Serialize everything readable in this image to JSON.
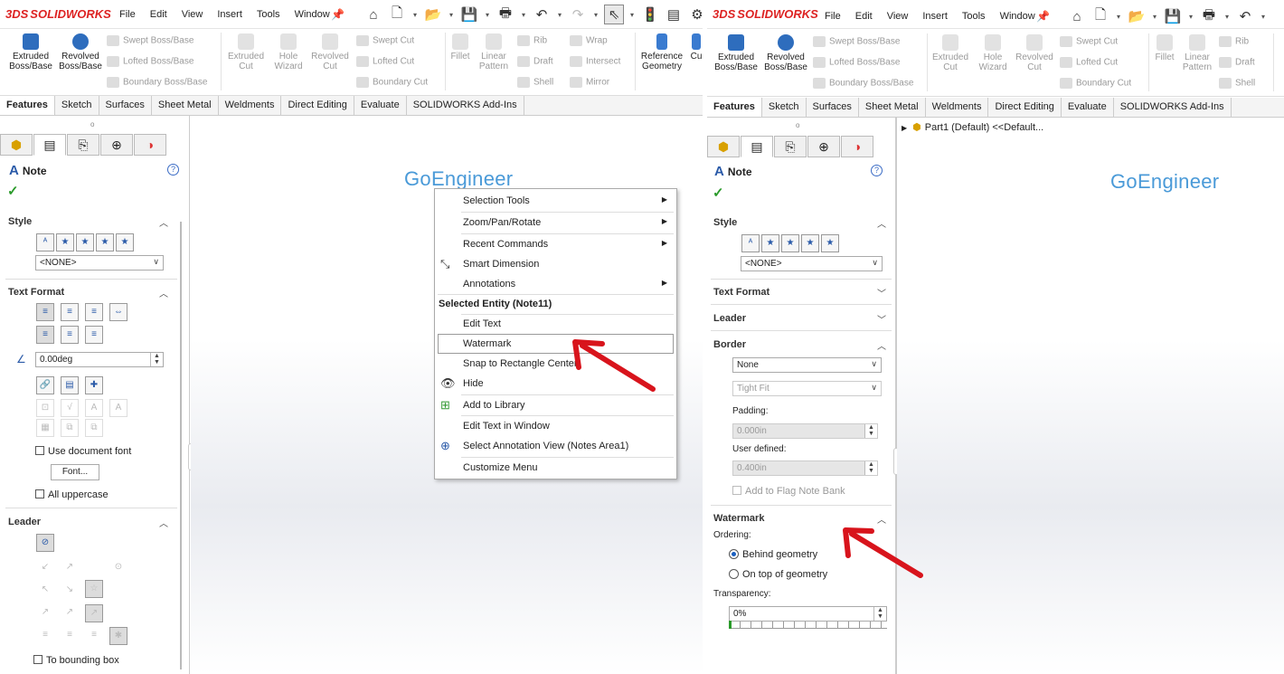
{
  "app": {
    "logo_text": "SOLIDWORKS",
    "logo_mark": "3DS"
  },
  "menu": [
    "File",
    "Edit",
    "View",
    "Insert",
    "Tools",
    "Window"
  ],
  "ribbon": {
    "extruded_boss": "Extruded\nBoss/Base",
    "revolved_boss": "Revolved\nBoss/Base",
    "swept_boss": "Swept Boss/Base",
    "lofted_boss": "Lofted Boss/Base",
    "boundary_boss": "Boundary Boss/Base",
    "extruded_cut": "Extruded\nCut",
    "hole_wizard": "Hole\nWizard",
    "revolved_cut": "Revolved\nCut",
    "swept_cut": "Swept Cut",
    "lofted_cut": "Lofted Cut",
    "boundary_cut": "Boundary Cut",
    "fillet": "Fillet",
    "linear_pattern": "Linear\nPattern",
    "rib": "Rib",
    "draft": "Draft",
    "shell": "Shell",
    "wrap": "Wrap",
    "intersect": "Intersect",
    "mirror": "Mirror",
    "reference_geometry": "Reference\nGeometry",
    "cu": "Cu"
  },
  "tabs": [
    "Features",
    "Sketch",
    "Surfaces",
    "Sheet Metal",
    "Weldments",
    "Direct Editing",
    "Evaluate",
    "SOLIDWORKS Add-Ins"
  ],
  "pm": {
    "title": "Note",
    "style_label": "Style",
    "style_value": "<NONE>",
    "text_format_label": "Text Format",
    "angle_value": "0.00deg",
    "use_doc_font": "Use document font",
    "font_button": "Font...",
    "all_uppercase": "All uppercase",
    "leader_label": "Leader",
    "to_bounding_box": "To bounding box"
  },
  "watermark_brand": "GoEngineer",
  "context_menu": {
    "items": [
      {
        "label": "Selection Tools",
        "sub": true
      },
      {
        "label": "Zoom/Pan/Rotate",
        "sub": true
      },
      {
        "label": "Recent Commands",
        "sub": true
      },
      {
        "label": "Smart Dimension",
        "sub": false
      },
      {
        "label": "Annotations",
        "sub": true
      }
    ],
    "header": "Selected Entity (Note11)",
    "entity_items": [
      "Edit Text",
      "Watermark",
      "Snap to Rectangle Center",
      "Hide",
      "Add to Library",
      "Edit Text in Window",
      "Select Annotation View (Notes Area1)",
      "Customize Menu"
    ],
    "highlighted": "Watermark"
  },
  "right_pm": {
    "tree_item": "Part1 (Default) <<Default...",
    "title": "Note",
    "style_label": "Style",
    "style_value": "<NONE>",
    "text_format_label": "Text Format",
    "leader_label": "Leader",
    "border_label": "Border",
    "border_value": "None",
    "fit_value": "Tight Fit",
    "padding_label": "Padding:",
    "padding_value": "0.000in",
    "user_defined_label": "User defined:",
    "user_defined_value": "0.400in",
    "flag_note": "Add to Flag Note Bank",
    "watermark_label": "Watermark",
    "ordering_label": "Ordering:",
    "behind": "Behind geometry",
    "on_top": "On top of geometry",
    "transparency_label": "Transparency:",
    "transparency_value": "0%",
    "transparency_level": 0
  },
  "colors": {
    "accent": "#1a5fc0",
    "arrow": "#d8141c",
    "brand": "#4a9ad8",
    "logo": "#d22222"
  }
}
